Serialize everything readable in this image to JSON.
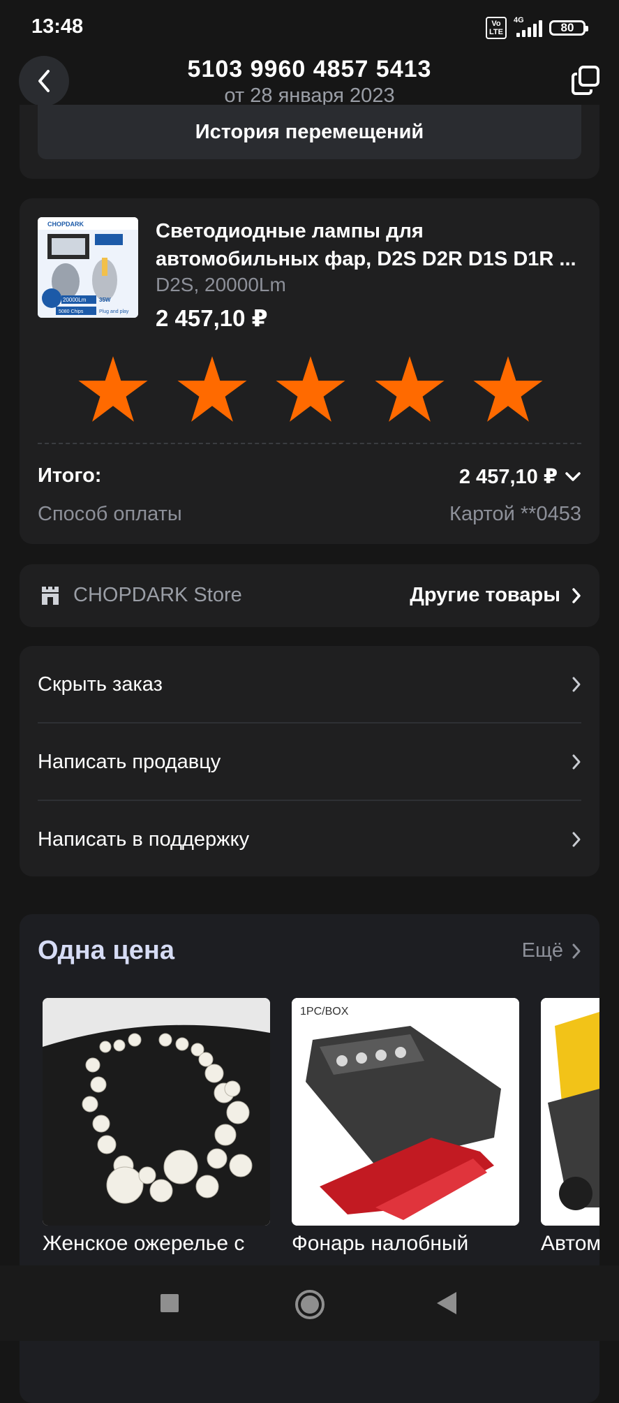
{
  "status_bar": {
    "time": "13:48",
    "volte": "Vo\nLTE",
    "network": "4G",
    "battery": "80"
  },
  "header": {
    "order_number": "5103 9960 4857 5413",
    "order_date": "от 28 января 2023",
    "back_icon": "chevron-left-icon",
    "copy_icon": "copy-icon"
  },
  "history_button": "История перемещений",
  "product": {
    "title_line1": "Светодиодные лампы для",
    "title_line2": "автомобильных фар, D2S D2R D1S D1R ...",
    "variant": "D2S, 20000Lm",
    "price": "2 457,10 ₽",
    "thumb_text": {
      "brand": "CHOPDARK",
      "spec1": "20000Lm",
      "spec2": "35W",
      "chips": "5080 Chips",
      "plug": "Plug and play"
    },
    "rating": 5,
    "star_color": "#ff6a00"
  },
  "totals": {
    "total_label": "Итого:",
    "total_value": "2 457,10 ₽",
    "payment_label": "Способ оплаты",
    "payment_value": "Картой **0453"
  },
  "store": {
    "name": "CHOPDARK Store",
    "link": "Другие товары"
  },
  "actions": [
    {
      "label": "Скрыть заказ"
    },
    {
      "label": "Написать продавцу"
    },
    {
      "label": "Написать в поддержку"
    }
  ],
  "same_price": {
    "title": "Одна цена",
    "more": "Ещё",
    "items": [
      {
        "name": "Женское ожерелье с"
      },
      {
        "name": "Фонарь налобный",
        "image_label": "1PC/BOX"
      },
      {
        "name": "Автом"
      }
    ]
  }
}
